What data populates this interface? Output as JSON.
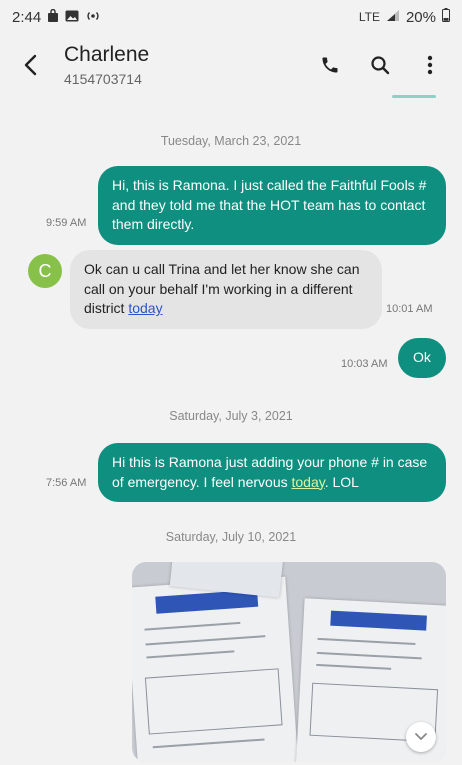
{
  "status_bar": {
    "time": "2:44",
    "network": "LTE",
    "battery": "20%"
  },
  "header": {
    "contact_name": "Charlene",
    "contact_number": "4154703714"
  },
  "dates": [
    "Tuesday, March 23, 2021",
    "Saturday, July 3, 2021",
    "Saturday, July 10, 2021"
  ],
  "messages": [
    {
      "direction": "out",
      "text": "Hi, this is Ramona.  I just called the Faithful Fools # and they told me that the HOT team has to contact them directly.",
      "time": "9:59 AM"
    },
    {
      "direction": "in",
      "avatar_letter": "C",
      "text_before_link": "Ok can u call Trina and let her know she can call on your behalf I'm working in a different district ",
      "link": "today",
      "time": "10:01 AM"
    },
    {
      "direction": "out",
      "text": "Ok",
      "time": "10:03 AM"
    },
    {
      "direction": "out",
      "text_before_link": "Hi this is Ramona just adding your phone # in case of emergency.   I feel nervous ",
      "link": "today",
      "text_after_link": ".  LOL",
      "time": "7:56 AM"
    }
  ],
  "colors": {
    "outgoing_bubble": "#0e8f80",
    "incoming_bubble": "#e4e4e4",
    "avatar": "#88c14a"
  }
}
